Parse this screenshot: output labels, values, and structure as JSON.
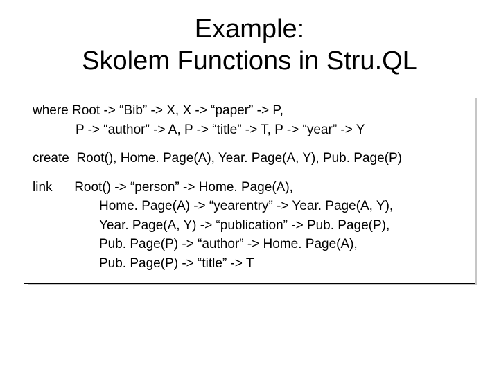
{
  "title_line1": "Example:",
  "title_line2": "Skolem Functions in Stru.QL",
  "where": {
    "kw": "where",
    "line1": "Root -> “Bib” -> X, X -> “paper” -> P,",
    "line2": "P -> “author” -> A, P -> “title” -> T, P -> “year” -> Y"
  },
  "create": {
    "kw": "create",
    "line1": "Root(), Home. Page(A), Year. Page(A, Y), Pub. Page(P)"
  },
  "link": {
    "kw": "link",
    "line1": "Root() -> “person” -> Home. Page(A),",
    "line2": "Home. Page(A) -> “yearentry” -> Year. Page(A, Y),",
    "line3": "Year. Page(A, Y) -> “publication” -> Pub. Page(P),",
    "line4": "Pub. Page(P) -> “author” -> Home. Page(A),",
    "line5": "Pub. Page(P) -> “title” -> T"
  }
}
